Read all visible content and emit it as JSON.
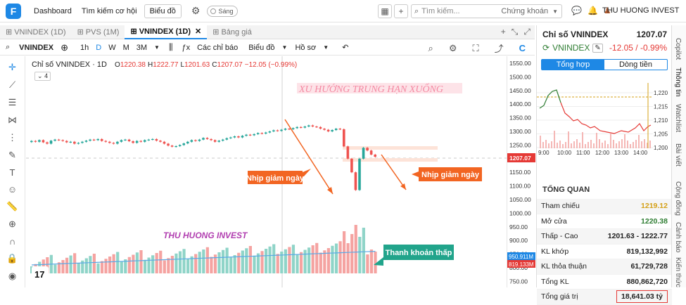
{
  "topbar": {
    "logo": "F",
    "nav_dashboard": "Dashboard",
    "nav_opportunity": "Tìm kiếm cơ hội",
    "nav_chart": "Biểu đồ",
    "theme_toggle": "Sáng",
    "search_placeholder": "Tìm kiếm...",
    "search_scope": "Chứng khoán",
    "user_name": "THU HUONG INVEST"
  },
  "tabs": [
    {
      "label": "VNINDEX (1D)"
    },
    {
      "label": "PVS (1M)"
    },
    {
      "label": "VNINDEX (1D)"
    },
    {
      "label": "Bảng giá"
    }
  ],
  "toolbar": {
    "symbol": "VNINDEX",
    "intervals": [
      "1h",
      "D",
      "W",
      "M",
      "3M"
    ],
    "indicators": "Các chỉ báo",
    "chart_menu": "Biểu đồ",
    "profile": "Hồ sơ"
  },
  "legend": {
    "title": "Chỉ số VNINDEX · 1D",
    "o_label": "O",
    "o": "1220.38",
    "h_label": "H",
    "h": "1222.77",
    "l_label": "L",
    "l": "1201.63",
    "c_label": "C",
    "c": "1207.07",
    "change": "−12.05 (−0.99%)",
    "indicator_count": "4"
  },
  "annotations": {
    "headline": "XU HƯỚNG TRUNG HẠN XUỐNG",
    "drop_1": "Nhịp giảm ngày",
    "drop_2": "Nhịp giảm ngày",
    "watermark": "THU HUONG INVEST",
    "liquidity": "Thanh khoản thấp"
  },
  "price_axis": {
    "ticks": [
      "1550.00",
      "1500.00",
      "1450.00",
      "1400.00",
      "1350.00",
      "1300.00",
      "1250.00",
      "1200.00",
      "1150.00",
      "1100.00",
      "1050.00",
      "1000.00",
      "950.00",
      "900.00",
      "850.00",
      "800.00",
      "750.00"
    ],
    "last_price": "1207.07",
    "vol_label_1": "950.911M",
    "vol_label_2": "819.133M"
  },
  "right_panel": {
    "title": "Chỉ số VNINDEX",
    "price": "1207.07",
    "symbol": "VNINDEX",
    "change": "-12.05 / -0.99%",
    "tab_summary": "Tổng hợp",
    "tab_cashflow": "Dòng tiền",
    "mini_y": [
      "1,220",
      "1,215",
      "1,210",
      "1,205",
      "1,200"
    ],
    "mini_x": [
      "9:00",
      "10:00",
      "11:00",
      "12:00",
      "13:00",
      "14:00"
    ],
    "overview_title": "TỔNG QUAN",
    "rows": [
      {
        "label": "Tham chiếu",
        "value": "1219.12",
        "color": "#d4a017"
      },
      {
        "label": "Mở cửa",
        "value": "1220.38",
        "color": "#2e7d32"
      },
      {
        "label": "Thấp - Cao",
        "value": "1201.63 - 1222.77",
        "color": "#222"
      },
      {
        "label": "KL khớp",
        "value": "819,132,992",
        "color": "#222"
      },
      {
        "label": "KL thỏa thuận",
        "value": "61,729,728",
        "color": "#222"
      },
      {
        "label": "Tổng KL",
        "value": "880,862,720",
        "color": "#222"
      },
      {
        "label": "Tổng giá trị",
        "value": "18,641.03 tỷ",
        "color": "#222"
      }
    ]
  },
  "vertical_tabs": [
    "Copilot",
    "Thông tin",
    "Watchlist",
    "Bài viết",
    "Cộng đồng",
    "Cảnh báo",
    "Kiến thức"
  ],
  "chart_data": {
    "type": "candlestick",
    "title": "Chỉ số VNINDEX · 1D",
    "ylim": [
      750,
      1550
    ],
    "candles_close": [
      1265,
      1262,
      1268,
      1260,
      1255,
      1266,
      1270,
      1268,
      1265,
      1260,
      1262,
      1255,
      1258,
      1262,
      1266,
      1270,
      1268,
      1272,
      1265,
      1262,
      1258,
      1255,
      1262,
      1268,
      1270,
      1264,
      1258,
      1265,
      1262,
      1268,
      1270,
      1272,
      1266,
      1262,
      1255,
      1248,
      1244,
      1246,
      1250,
      1256,
      1262,
      1268,
      1265,
      1270,
      1276,
      1272,
      1268,
      1262,
      1266,
      1270,
      1275,
      1278,
      1282,
      1278,
      1284,
      1288,
      1286,
      1290,
      1294,
      1292,
      1296,
      1300,
      1304,
      1302,
      1306,
      1310,
      1308,
      1312,
      1316,
      1314,
      1318,
      1322,
      1318,
      1316,
      1310,
      1306,
      1300,
      1305,
      1310,
      1308,
      1245,
      1200,
      1150,
      1085,
      1200,
      1240,
      1230,
      1215,
      1207
    ],
    "volume_series": {
      "name": "",
      "last": 950.911,
      "ma": 819.133
    }
  }
}
